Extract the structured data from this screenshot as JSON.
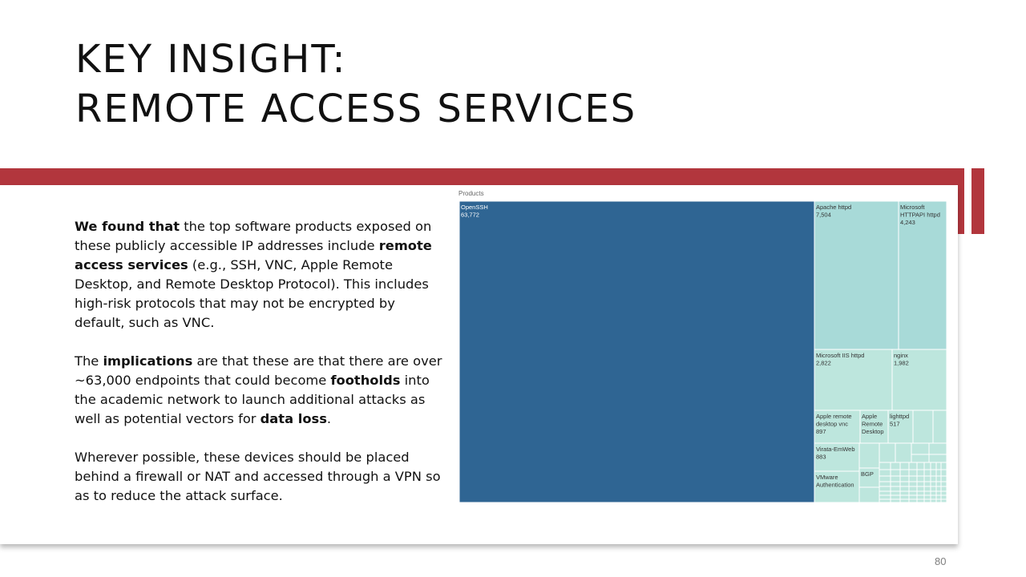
{
  "slide": {
    "title_line1": "KEY INSIGHT:",
    "title_line2": "REMOTE ACCESS SERVICES",
    "page_number": "80",
    "accent_color": "#b2363d"
  },
  "paragraphs": [
    [
      {
        "t": "We found that",
        "b": true
      },
      {
        "t": " the top software products exposed on these publicly accessible IP addresses include ",
        "b": false
      },
      {
        "t": "remote access services",
        "b": true
      },
      {
        "t": " (e.g., SSH, VNC, Apple Remote Desktop, and Remote Desktop Protocol). This includes high-risk protocols that may not be encrypted by default, such as VNC.",
        "b": false
      }
    ],
    [
      {
        "t": "The ",
        "b": false
      },
      {
        "t": "implications",
        "b": true
      },
      {
        "t": " are that these are that there are over ~63,000 endpoints that could become ",
        "b": false
      },
      {
        "t": "footholds",
        "b": true
      },
      {
        "t": " into the academic network to launch additional attacks as well as potential vectors for ",
        "b": false
      },
      {
        "t": "data loss",
        "b": true
      },
      {
        "t": ".",
        "b": false
      }
    ],
    [
      {
        "t": "Wherever possible, these devices should be placed behind a firewall or NAT and accessed through a VPN so as to reduce the attack surface.",
        "b": false
      }
    ]
  ],
  "chart_data": {
    "type": "treemap",
    "title": "Products",
    "colors": {
      "largest": "#2f6593",
      "large": "#a8dad8",
      "medium": "#bde6dd"
    },
    "items": [
      {
        "name": "OpenSSH",
        "value": 63772,
        "label": [
          "OpenSSH",
          "63,772"
        ]
      },
      {
        "name": "Apache httpd",
        "value": 7504,
        "label": [
          "Apache httpd",
          "7,504"
        ]
      },
      {
        "name": "Microsoft HTTPAPI httpd",
        "value": 4243,
        "label": [
          "Microsoft",
          "HTTPAPI httpd",
          "4,243"
        ]
      },
      {
        "name": "Microsoft IIS httpd",
        "value": 2822,
        "label": [
          "Microsoft IIS httpd",
          "2,822"
        ]
      },
      {
        "name": "nginx",
        "value": 1982,
        "label": [
          "nginx",
          "1,982"
        ]
      },
      {
        "name": "Apple remote desktop vnc",
        "value": 897,
        "label": [
          "Apple remote",
          "desktop vnc",
          "897"
        ]
      },
      {
        "name": "Apple Remote Desktop",
        "value": null,
        "label": [
          "Apple",
          "Remote",
          "Desktop"
        ]
      },
      {
        "name": "lighttpd",
        "value": 517,
        "label": [
          "lighttpd",
          "517"
        ]
      },
      {
        "name": "Virata-EmWeb",
        "value": 883,
        "label": [
          "Virata-EmWeb",
          "883"
        ]
      },
      {
        "name": "BGP",
        "value": null,
        "label": [
          "BGP"
        ]
      },
      {
        "name": "VMware Authentication",
        "value": null,
        "label": [
          "VMware",
          "Authentication"
        ]
      }
    ]
  }
}
